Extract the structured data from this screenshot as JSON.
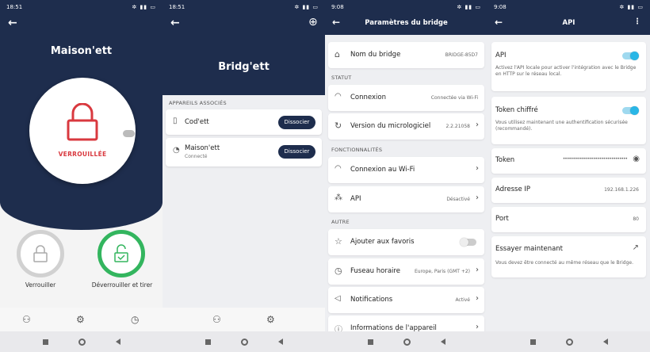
{
  "p1": {
    "status_time": "18:51",
    "title": "Maison'ett",
    "lock_state": "VERROUILLÉE",
    "lock_action": "Verrouiller",
    "unlock_action": "Déverrouiller et tirer",
    "colors": {
      "navy": "#1e2d4d",
      "red": "#d9393f",
      "green": "#33b55e"
    }
  },
  "p2": {
    "status_time": "18:51",
    "title": "Bridg'ett",
    "section": "APPAREILS ASSOCIÉS",
    "devices": [
      {
        "name": "Cod'ett",
        "sub": "",
        "action": "Dissocier"
      },
      {
        "name": "Maison'ett",
        "sub": "Connecté",
        "action": "Dissocier"
      }
    ]
  },
  "p3": {
    "status_time": "9:08",
    "title": "Paramètres du bridge",
    "bridge_name": {
      "label": "Nom du bridge",
      "value": "BRIDGE-85D7"
    },
    "sec_status": "STATUT",
    "connexion": {
      "label": "Connexion",
      "value": "Connectée via Wi-Fi"
    },
    "firmware": {
      "label": "Version du micrologiciel",
      "value": "2.2.21058"
    },
    "sec_features": "FONCTIONNALITÉS",
    "wifi": {
      "label": "Connexion au Wi-Fi"
    },
    "api": {
      "label": "API",
      "value": "Désactivé"
    },
    "sec_other": "AUTRE",
    "favorites": {
      "label": "Ajouter aux favoris"
    },
    "timezone": {
      "label": "Fuseau horaire",
      "value": "Europe, Paris (GMT +2)"
    },
    "notifications": {
      "label": "Notifications",
      "value": "Activé"
    },
    "device_info": {
      "label": "Informations de l'appareil"
    }
  },
  "p4": {
    "status_time": "9:08",
    "title": "API",
    "api": {
      "label": "API",
      "desc": "Activez l'API locale pour activer l'intégration avec le Bridge en HTTP sur le réseau local."
    },
    "token_enc": {
      "label": "Token chiffré",
      "desc": "Vous utilisez maintenant une authentification sécurisée (recommandé)."
    },
    "token": {
      "label": "Token",
      "value": "••••••••••••••••••••••••••••••••"
    },
    "ip": {
      "label": "Adresse IP",
      "value": "192.168.1.226"
    },
    "port": {
      "label": "Port",
      "value": "80"
    },
    "try": {
      "label": "Essayer maintenant",
      "desc": "Vous devez être connecté au même réseau que le Bridge."
    }
  }
}
